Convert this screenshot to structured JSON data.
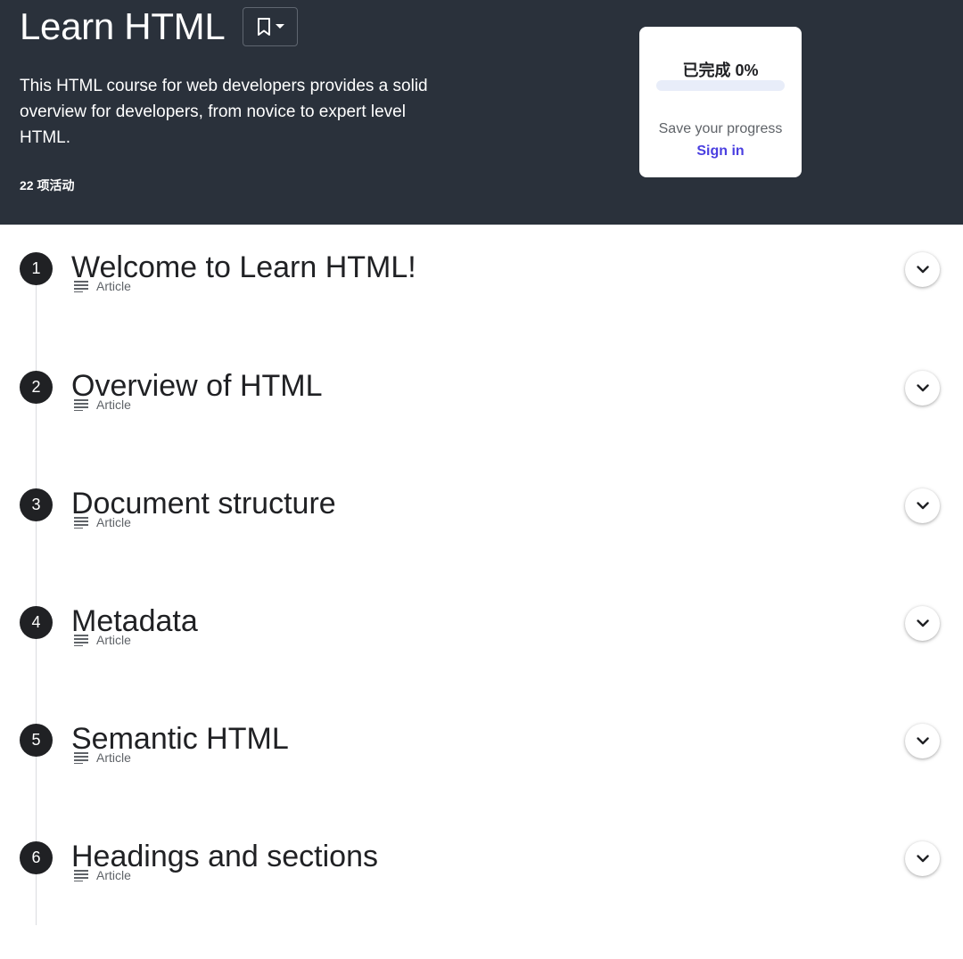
{
  "header": {
    "title": "Learn HTML",
    "description": "This HTML course for web developers provides a solid overview for developers, from novice to expert level HTML.",
    "activity_count": "22 项活动",
    "bookmark_icon": "bookmark-icon",
    "dropdown_icon": "caret-down-icon",
    "background_color": "#2a313b"
  },
  "progress": {
    "title": "已完成 0%",
    "percent": 0,
    "save_text": "Save your progress",
    "sign_in_label": "Sign in",
    "accent_color": "#4a3fe0"
  },
  "modules": [
    {
      "number": "1",
      "title": "Welcome to Learn HTML!",
      "type": "Article"
    },
    {
      "number": "2",
      "title": "Overview of HTML",
      "type": "Article"
    },
    {
      "number": "3",
      "title": "Document structure",
      "type": "Article"
    },
    {
      "number": "4",
      "title": "Metadata",
      "type": "Article"
    },
    {
      "number": "5",
      "title": "Semantic HTML",
      "type": "Article"
    },
    {
      "number": "6",
      "title": "Headings and sections",
      "type": "Article"
    }
  ],
  "icons": {
    "article": "article-lines-icon",
    "expand": "chevron-down-icon"
  }
}
